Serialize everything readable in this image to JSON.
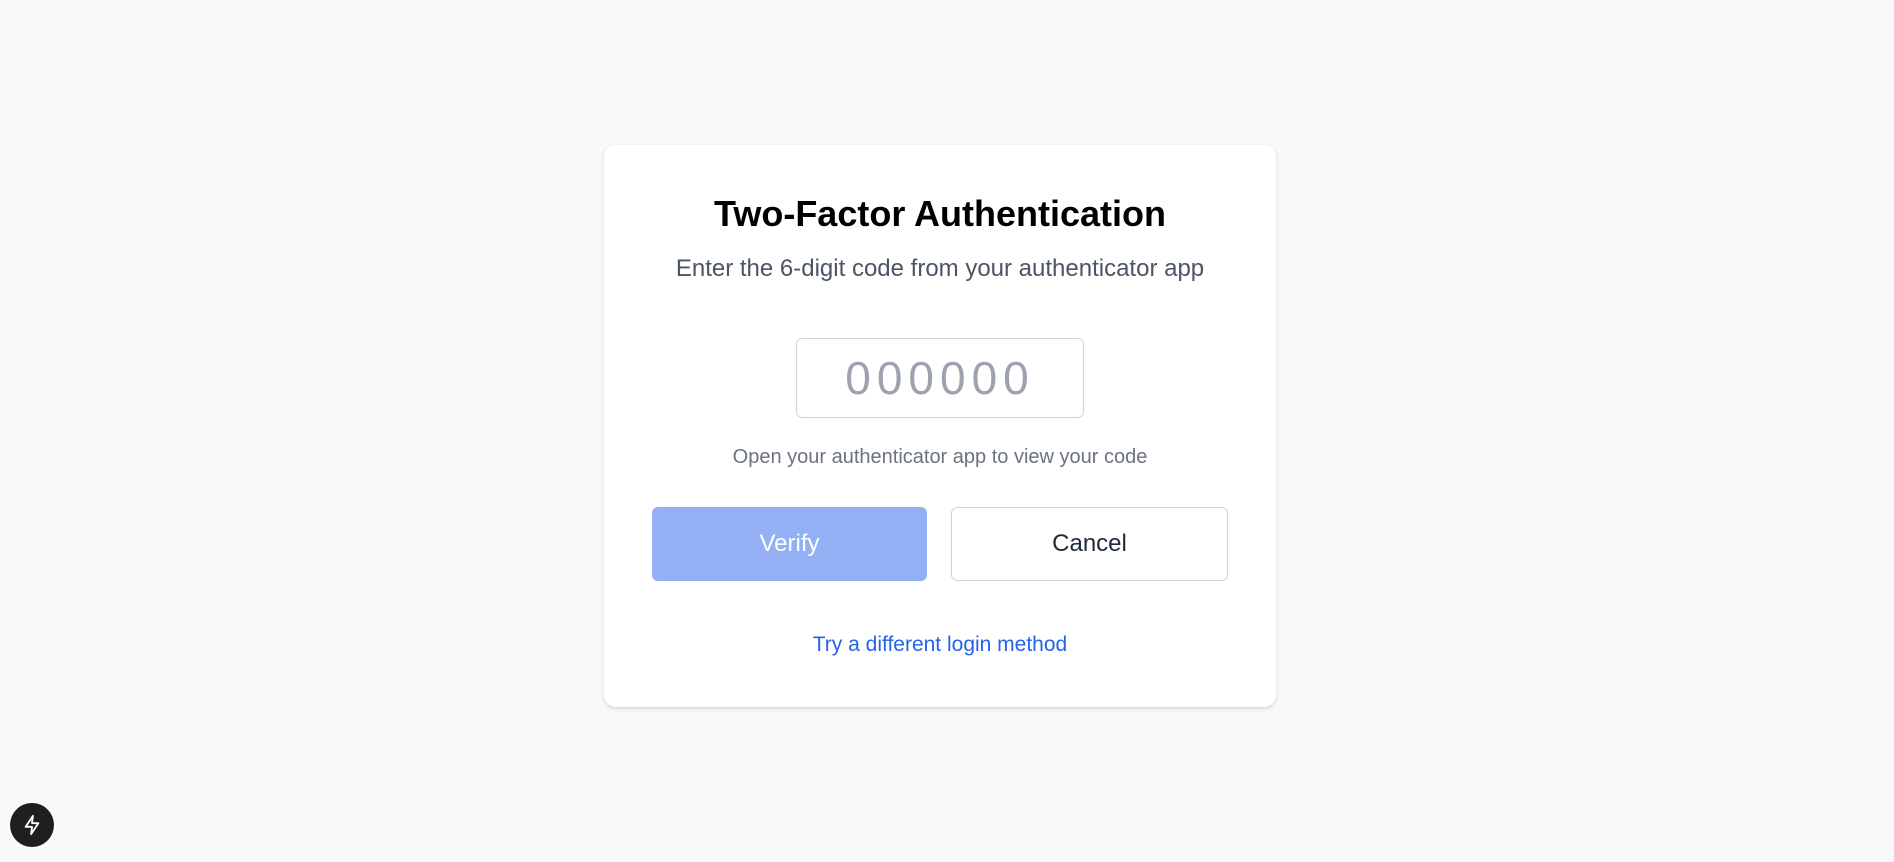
{
  "card": {
    "title": "Two-Factor Authentication",
    "subtitle": "Enter the 6-digit code from your authenticator app",
    "code_input": {
      "value": "",
      "placeholder": "000000"
    },
    "hint": "Open your authenticator app to view your code",
    "verify_label": "Verify",
    "cancel_label": "Cancel",
    "alt_link_label": "Try a different login method"
  },
  "dev_badge": {
    "icon": "lightning-icon"
  },
  "colors": {
    "background": "#f8f9fb",
    "card": "#ffffff",
    "verify_button_disabled": "#93b0f4",
    "link": "#2563eb",
    "badge": "#1f1f1f"
  }
}
